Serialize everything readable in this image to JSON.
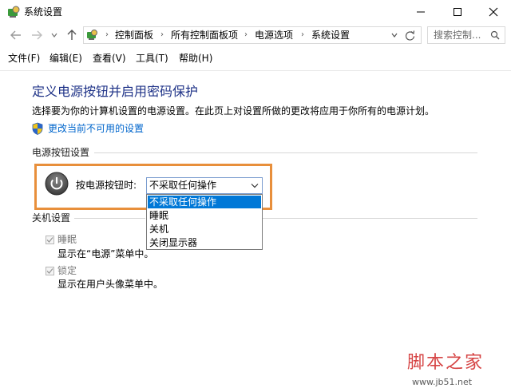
{
  "window": {
    "title": "系统设置"
  },
  "address_bar": {
    "breadcrumbs": [
      "控制面板",
      "所有控制面板项",
      "电源选项",
      "系统设置"
    ]
  },
  "search": {
    "placeholder": "搜索控制..."
  },
  "menu": {
    "items": [
      "文件(F)",
      "编辑(E)",
      "查看(V)",
      "工具(T)",
      "帮助(H)"
    ]
  },
  "content": {
    "title": "定义电源按钮并启用密码保护",
    "description": "选择要为你的计算机设置的电源设置。在此页上对设置所做的更改将应用于你所有的电源计划。",
    "change_link": "更改当前不可用的设置"
  },
  "power_button_section": {
    "heading": "电源按钮设置",
    "label": "按电源按钮时:",
    "selected_value": "不采取任何操作",
    "options": [
      "不采取任何操作",
      "睡眠",
      "关机",
      "关闭显示器"
    ],
    "highlighted_index": 0
  },
  "shutdown_section": {
    "heading": "关机设置",
    "items": [
      {
        "label": "睡眠",
        "description": "显示在“电源”菜单中。",
        "checked": true
      },
      {
        "label": "锁定",
        "description": "显示在用户头像菜单中。",
        "checked": true
      }
    ]
  },
  "watermark": {
    "brand": "脚本之家",
    "url": "www.jb51.net"
  },
  "colors": {
    "accent": "#0078d7",
    "title": "#1e3287",
    "link": "#0066cc",
    "highlight_border": "#e88f3b"
  }
}
